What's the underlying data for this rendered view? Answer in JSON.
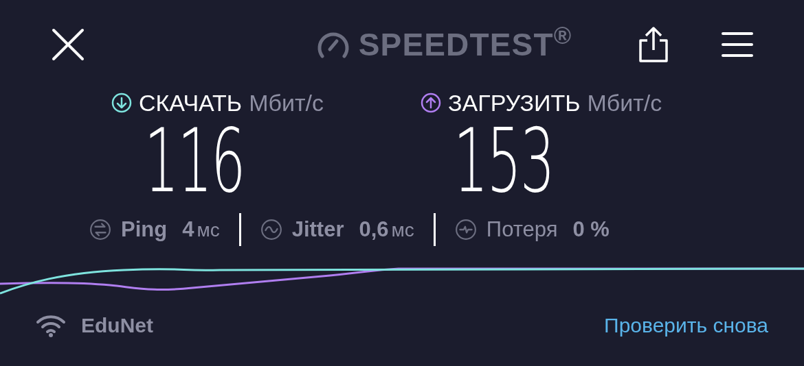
{
  "logo": {
    "text": "SPEEDTEST",
    "mark": "®"
  },
  "results": [
    {
      "kind": "download",
      "label": "СКАЧАТЬ",
      "unit": "Мбит/с",
      "value": "116",
      "color": "#7ee3de"
    },
    {
      "kind": "upload",
      "label": "ЗАГРУЗИТЬ",
      "unit": "Мбит/с",
      "value": "153",
      "color": "#b07ef0"
    }
  ],
  "stats": [
    {
      "kind": "ping",
      "label": "Ping",
      "value": "4",
      "unit": "мс"
    },
    {
      "kind": "jitter",
      "label": "Jitter",
      "value": "0,6",
      "unit": "мс"
    },
    {
      "kind": "loss",
      "label": "Потеря",
      "value": "0 %"
    }
  ],
  "network": {
    "name": "EduNet"
  },
  "retry_link": "Проверить снова"
}
